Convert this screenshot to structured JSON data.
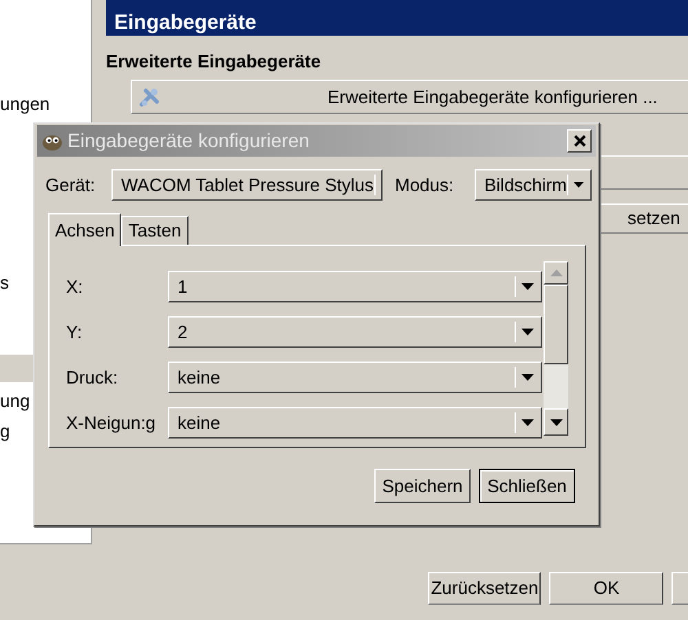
{
  "background_window": {
    "sidebar": {
      "items": [
        {
          "label": "ungen",
          "selected": false
        },
        {
          "label": "s",
          "selected": false
        },
        {
          "selected": true
        },
        {
          "label": "ung",
          "selected": false
        },
        {
          "label": "g",
          "selected": false
        }
      ]
    },
    "header": {
      "title": "Eingabegeräte"
    },
    "section": {
      "heading": "Erweiterte Eingabegeräte",
      "button": "Erweiterte Eingabegeräte konfigurieren ..."
    },
    "partial_button": "setzen",
    "buttons": [
      {
        "label": "Zurücksetzen"
      },
      {
        "label": "OK"
      }
    ]
  },
  "dialog": {
    "title": "Eingabegeräte konfigurieren",
    "device": {
      "label": "Gerät:",
      "value": "WACOM Tablet Pressure Stylus"
    },
    "mode": {
      "label": "Modus:",
      "value": "Bildschirm"
    },
    "tabs": [
      {
        "label": "Achsen",
        "selected": true
      },
      {
        "label": "Tasten",
        "selected": false
      }
    ],
    "axes": [
      {
        "label": "X:",
        "value": "1"
      },
      {
        "label": "Y:",
        "value": "2"
      },
      {
        "label": "Druck:",
        "value": "keine"
      },
      {
        "label": "X-Neigun:g",
        "value": "keine"
      }
    ],
    "buttons": [
      {
        "label": "Speichern",
        "default": false
      },
      {
        "label": "Schließen",
        "default": true
      }
    ]
  }
}
